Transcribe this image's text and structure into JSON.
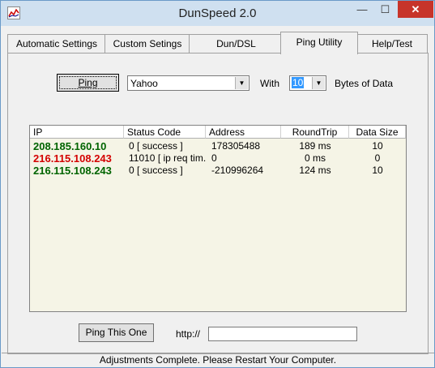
{
  "window": {
    "title": "DunSpeed 2.0",
    "min": "—",
    "max": "☐",
    "close": "✕"
  },
  "tabs": [
    "Automatic Settings",
    "Custom Setings",
    "Dun/DSL",
    "Ping Utility",
    "Help/Test"
  ],
  "ping": {
    "button": "Ping",
    "host": "Yahoo",
    "with_label": "With",
    "count": "10",
    "bytes_label": "Bytes of Data"
  },
  "table": {
    "headers": [
      "IP",
      "Status Code",
      "Address",
      "RoundTrip",
      "Data Size"
    ],
    "rows": [
      {
        "ip": "208.185.160.10",
        "status": "0 [ success ]",
        "address": "178305488",
        "roundtrip": "189 ms",
        "size": "10",
        "ok": true
      },
      {
        "ip": "216.115.108.243",
        "status": "11010 [ ip req tim...",
        "address": "0",
        "roundtrip": "0 ms",
        "size": "0",
        "ok": false
      },
      {
        "ip": "216.115.108.243",
        "status": "0 [ success ]",
        "address": "-210996264",
        "roundtrip": "124 ms",
        "size": "10",
        "ok": true
      }
    ]
  },
  "bottom": {
    "ping_one": "Ping This One",
    "http_label": "http://",
    "url_value": ""
  },
  "status_bar": "Adjustments Complete.  Please Restart Your Computer.",
  "colors": {
    "ok_ip": "#006400",
    "fail_ip": "#d40000",
    "list_bg": "#f5f4e6"
  }
}
